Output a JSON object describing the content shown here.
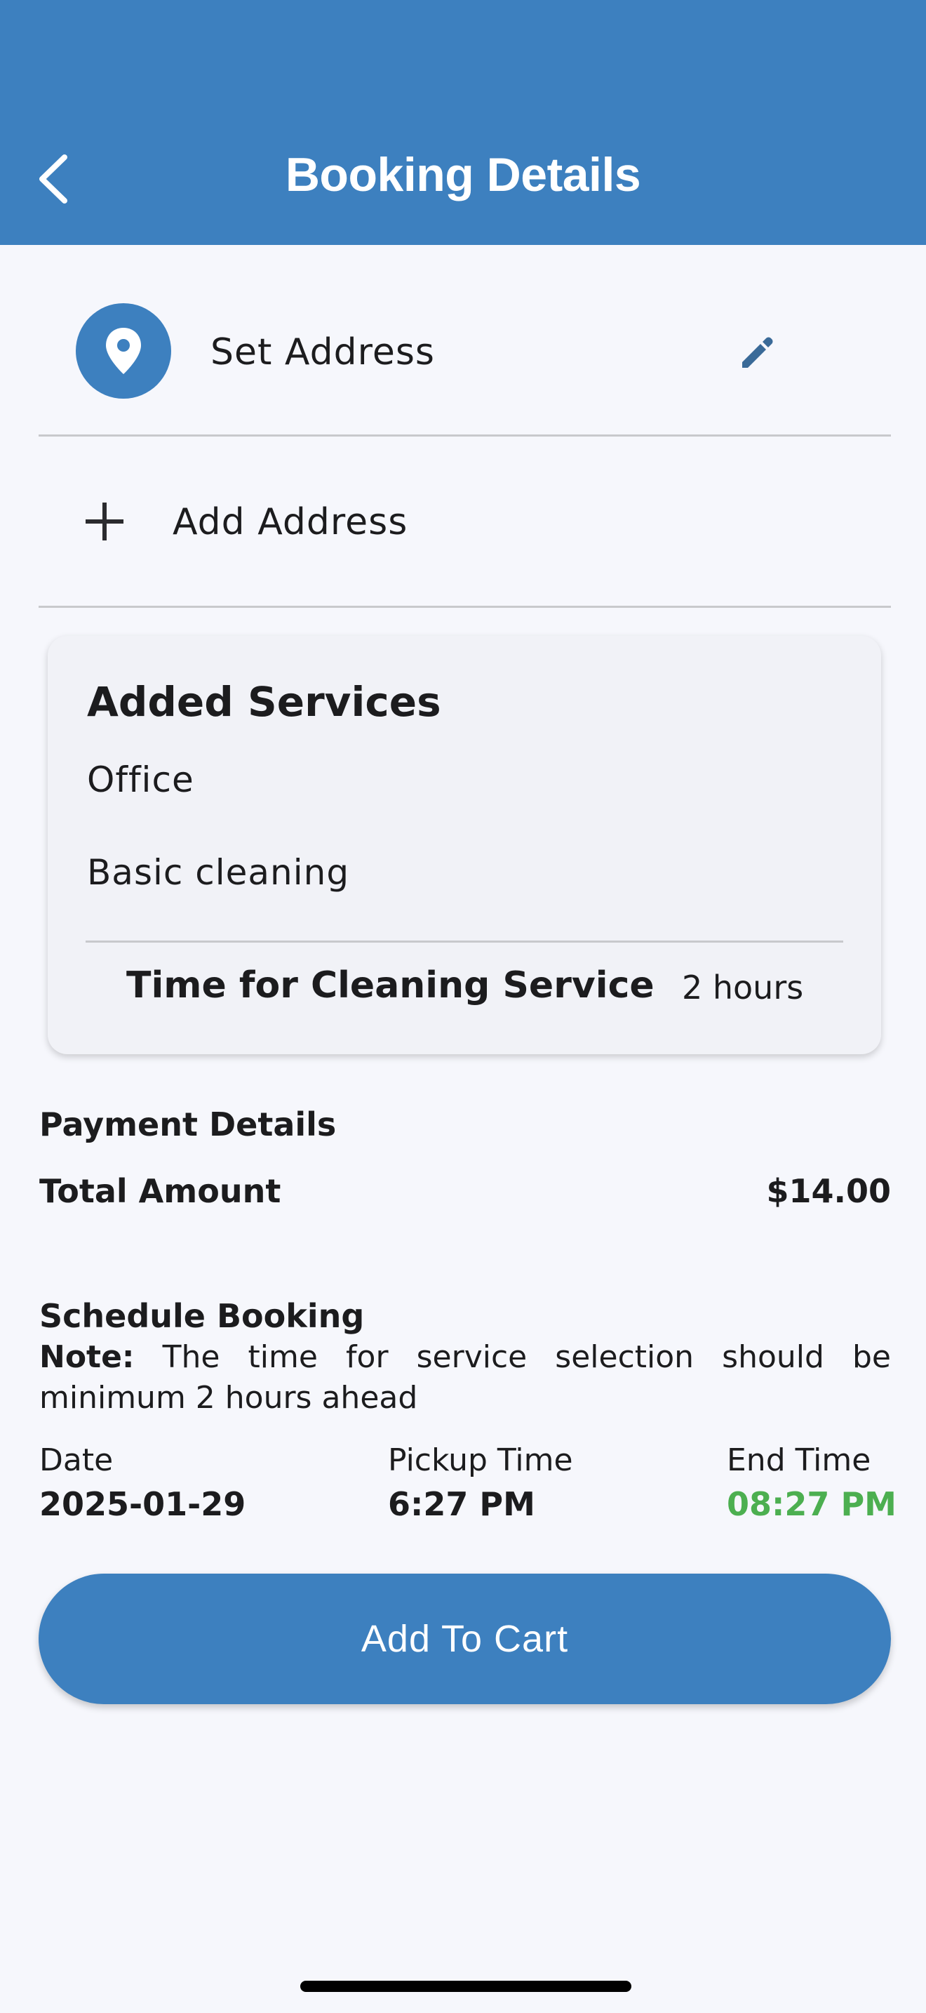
{
  "header": {
    "title": "Booking Details",
    "back_icon": "chevron-left-icon",
    "background": "#3d80bf"
  },
  "address": {
    "set_label": "Set Address",
    "pin_icon": "location-pin-icon",
    "edit_icon": "pencil-icon",
    "add_label": "Add Address",
    "add_icon": "plus-icon"
  },
  "services": {
    "title": "Added Services",
    "items": [
      "Office",
      "Basic cleaning"
    ],
    "time_label": "Time for Cleaning Service",
    "time_value": "2 hours"
  },
  "payment": {
    "heading": "Payment Details",
    "total_label": "Total Amount",
    "total_value": "$14.00"
  },
  "schedule": {
    "heading": "Schedule Booking",
    "note_label": "Note:",
    "note_text": "The time for service selection should be minimum 2 hours ahead",
    "date_label": "Date",
    "date_value": "2025-01-29",
    "pickup_label": "Pickup Time",
    "pickup_value": "6:27 PM",
    "end_label": "End Time",
    "end_value": "08:27 PM",
    "end_color": "#4caf50"
  },
  "actions": {
    "add_to_cart": "Add To Cart"
  }
}
